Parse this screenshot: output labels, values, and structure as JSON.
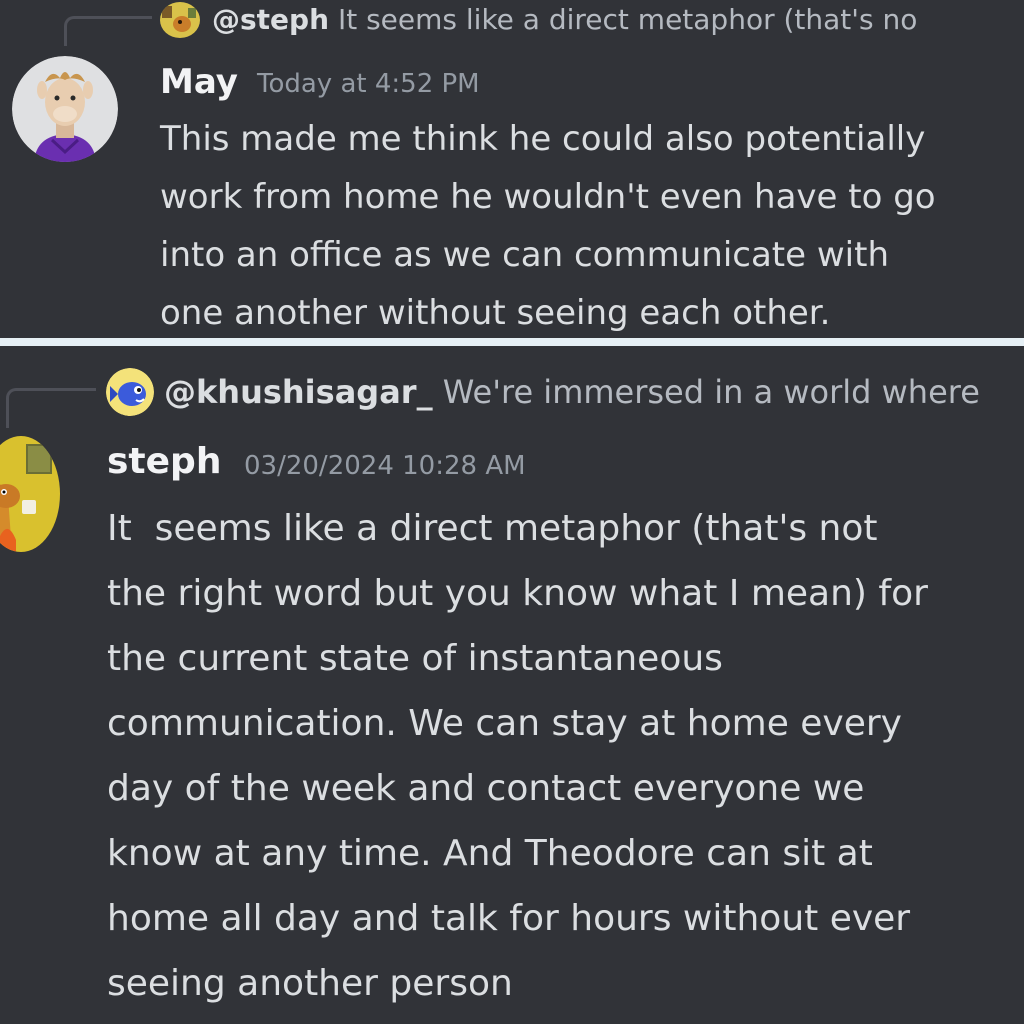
{
  "top_message": {
    "reply_preview": {
      "username": "@steph",
      "snippet": "It seems like a direct metaphor (that's no",
      "avatar_icon": "cartoon-dog-avatar-icon"
    },
    "author": "May",
    "timestamp": "Today at 4:52 PM",
    "avatar_icon": "llama-avatar-icon",
    "text": "This made me think he could also potentially\nwork from home he wouldn't even have to go\ninto an office as we can communicate with\none another without seeing each other."
  },
  "bottom_message": {
    "reply_preview": {
      "username": "@khushisagar_",
      "snippet": "We're immersed in a world where",
      "avatar_icon": "blue-fish-avatar-icon"
    },
    "author": "steph",
    "timestamp": "03/20/2024 10:28 AM",
    "avatar_icon": "this-is-fine-dog-avatar-icon",
    "text": "It  seems like a direct metaphor (that's not\nthe right word but you know what I mean) for\nthe current state of instantaneous\ncommunication. We can stay at home every\nday of the week and contact everyone we\nknow at any time. And Theodore can sit at\nhome all day and talk for hours without ever\nseeing another person"
  },
  "colors": {
    "background": "#313338",
    "divider": "#e6f0f5",
    "username": "#f2f3f5",
    "message_text": "#dbdee1",
    "timestamp": "#949ba4",
    "reply_line": "#4e5058"
  }
}
